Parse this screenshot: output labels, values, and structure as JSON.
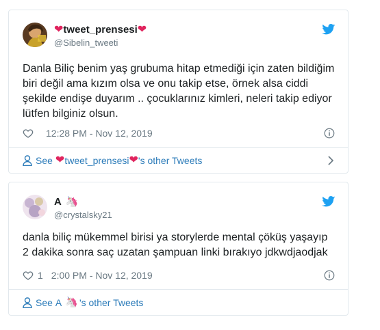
{
  "tweets": [
    {
      "display_name": "tweet_prensesi",
      "handle": "@Sibelin_tweeti",
      "text": "Danla Biliç benim yaş grubuma hitap etmediği için zaten bildiğim\nbiri değil ama kızım olsa ve onu takip etse, örnek alsa ciddi\nşekilde endişe duyarım .. çocuklarınız kimleri, neleri takip ediyor\nlütfen bilginiz olsun.",
      "like_count": "",
      "timestamp": "12:28 PM - Nov 12, 2019",
      "footer_prefix": "See",
      "footer_name": "tweet_prensesi",
      "footer_suffix": "'s other Tweets"
    },
    {
      "display_name": "A",
      "handle": "@crystalsky21",
      "text": "danla biliç mükemmel birisi ya storylerde mental çöküş yaşayıp\n2 dakika sonra saç uzatan şampuan linki bırakıyo jdkwdjaodjak",
      "like_count": "1",
      "timestamp": "2:00 PM - Nov 12, 2019",
      "footer_prefix": "See",
      "footer_name": "A",
      "footer_suffix": "'s other Tweets"
    }
  ],
  "colors": {
    "link": "#2b7bb9",
    "heart": "#e0245e",
    "twitter_blue": "#1da1f2",
    "muted": "#697882"
  },
  "icons": [
    "twitter-bird-icon",
    "heart-icon",
    "like-icon",
    "info-icon",
    "person-icon",
    "chevron-right-icon",
    "unicorn-emoji"
  ]
}
